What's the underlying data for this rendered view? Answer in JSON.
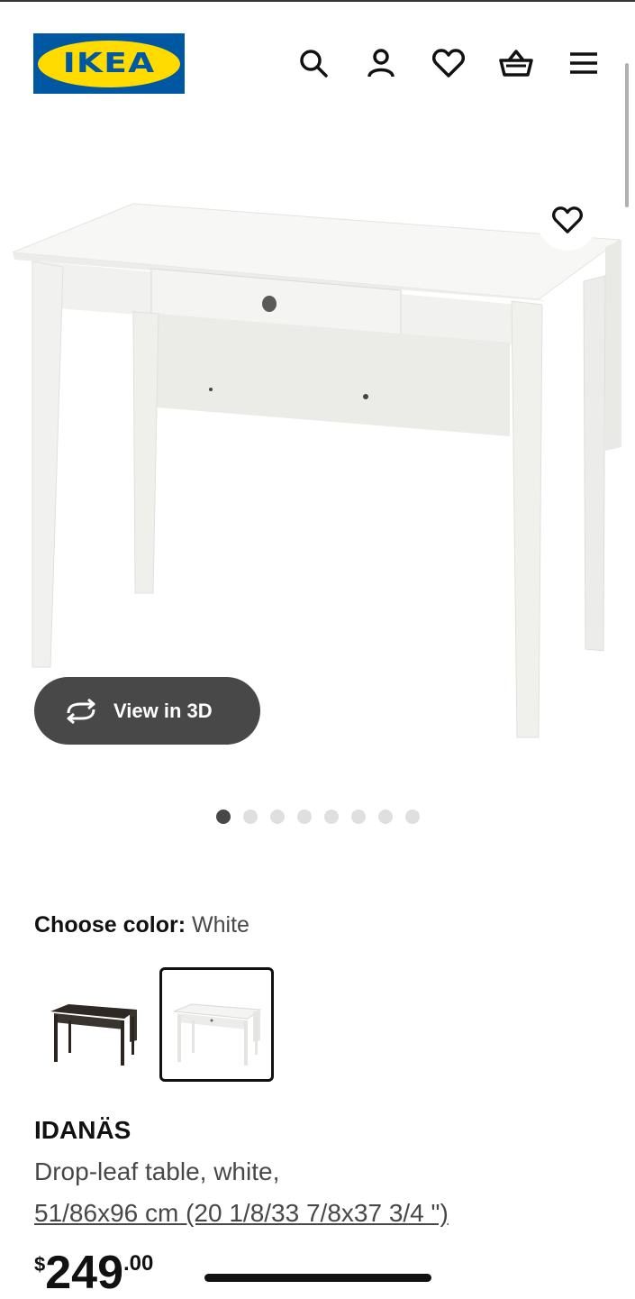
{
  "header": {
    "logo_text": "IKEA",
    "logo_reg": "®",
    "icons": [
      "search-icon",
      "account-icon",
      "heart-icon",
      "basket-icon",
      "menu-icon"
    ]
  },
  "product_image": {
    "view3d_label": "View in 3D",
    "carousel": {
      "total": 8,
      "active": 1
    }
  },
  "color_chooser": {
    "label": "Choose color:",
    "value": "White",
    "options": [
      {
        "name": "black-brown",
        "selected": false
      },
      {
        "name": "white",
        "selected": true
      }
    ]
  },
  "product": {
    "name": "IDANÄS",
    "description": "Drop-leaf table, white,",
    "size": "51/86x96 cm (20 1/8/33 7/8x37 3/4 \")",
    "price": {
      "currency": "$",
      "integer": "249",
      "decimal": ".00"
    }
  },
  "colors": {
    "ikea_blue": "#0058a3",
    "ikea_yellow": "#ffdb00",
    "button_dark": "#484848"
  }
}
